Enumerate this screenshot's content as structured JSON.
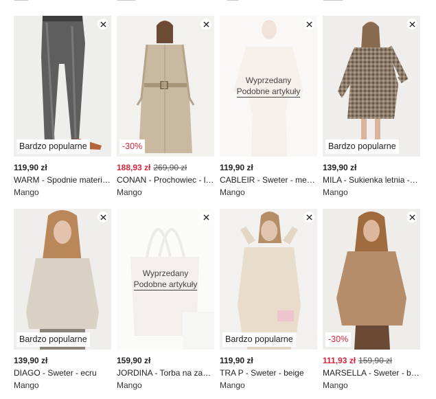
{
  "products": [
    {
      "id": "warm",
      "price": "119,90 zł",
      "orig_price": "",
      "name": "WARM - Spodnie materi…",
      "brand": "Mango",
      "badge": "Bardzo popularne",
      "soldout": "",
      "similar": "",
      "image": "grey checked trousers"
    },
    {
      "id": "conan",
      "price": "188,93 zł",
      "orig_price": "269,90 zł",
      "name": "CONAN - Prochowiec - l…",
      "brand": "Mango",
      "badge": "-30%",
      "soldout": "",
      "similar": "",
      "image": "beige trench coat"
    },
    {
      "id": "cableir",
      "price": "119,90 zł",
      "orig_price": "",
      "name": "CABLEIR - Sweter - me…",
      "brand": "Mango",
      "badge": "",
      "soldout": "Wyprzedany",
      "similar": "Podobne artykuły",
      "image": "cream sweater"
    },
    {
      "id": "mila",
      "price": "139,90 zł",
      "orig_price": "",
      "name": "MILA - Sukienka letnia -…",
      "brand": "Mango",
      "badge": "Bardzo popularne",
      "soldout": "",
      "similar": "",
      "image": "checked wrap dress"
    },
    {
      "id": "diago",
      "price": "139,90 zł",
      "orig_price": "",
      "name": "DIAGO - Sweter - ecru",
      "brand": "Mango",
      "badge": "Bardzo popularne",
      "soldout": "",
      "similar": "",
      "image": "ecru knit sweater"
    },
    {
      "id": "jordina",
      "price": "159,90 zł",
      "orig_price": "",
      "name": "JORDINA - Torba na za…",
      "brand": "Mango",
      "badge": "",
      "soldout": "Wyprzedany",
      "similar": "Podobne artykuły",
      "image": "canvas tote bag"
    },
    {
      "id": "trap",
      "price": "119,90 zł",
      "orig_price": "",
      "name": "TRA P - Sweter - beige",
      "brand": "Mango",
      "badge": "Bardzo popularne",
      "soldout": "",
      "similar": "",
      "image": "beige sweater"
    },
    {
      "id": "marsella",
      "price": "111,93 zł",
      "orig_price": "159,90 zł",
      "name": "MARSELLA - Sweter - b…",
      "brand": "Mango",
      "badge": "-30%",
      "soldout": "",
      "similar": "",
      "image": "camel sweater"
    }
  ],
  "colors": {
    "discount": "#d9233a",
    "text": "#222222",
    "badge_bg": "#ffffff"
  },
  "icons": {
    "remove": "close-icon"
  }
}
